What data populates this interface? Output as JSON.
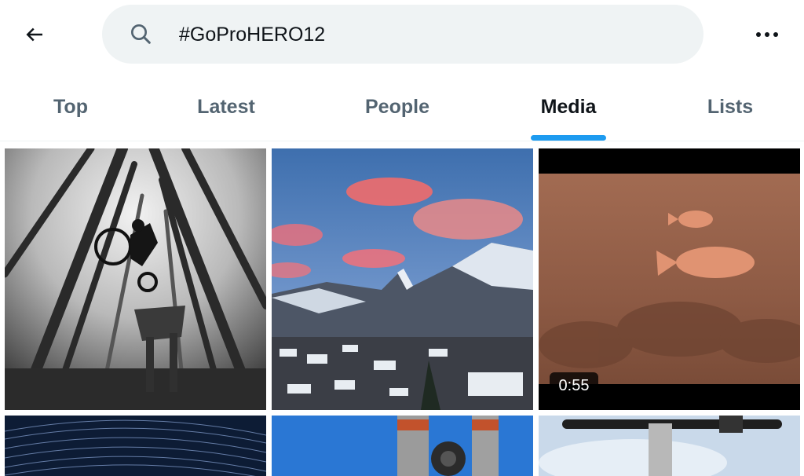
{
  "header": {
    "search_value": "#GoProHERO12",
    "back_icon": "arrow-left-icon",
    "search_icon": "search-icon",
    "more_icon": "more-horizontal-icon"
  },
  "tabs": [
    {
      "label": "Top",
      "active": false
    },
    {
      "label": "Latest",
      "active": false
    },
    {
      "label": "People",
      "active": false
    },
    {
      "label": "Media",
      "active": true
    },
    {
      "label": "Lists",
      "active": false
    }
  ],
  "colors": {
    "accent": "#1d9bf0",
    "search_bg": "#eff3f4",
    "text_primary": "#0f1419",
    "text_secondary": "#536471"
  },
  "media": [
    {
      "kind": "photo",
      "subject": "mountain biker jumping in foggy forest"
    },
    {
      "kind": "photo",
      "subject": "snowy mountain village at sunset"
    },
    {
      "kind": "video",
      "subject": "fish underwater",
      "duration": "0:55"
    },
    {
      "kind": "photo",
      "subject": "star trails"
    },
    {
      "kind": "photo",
      "subject": "bike fork against blue sky"
    },
    {
      "kind": "photo",
      "subject": "handlebars against sky"
    }
  ]
}
